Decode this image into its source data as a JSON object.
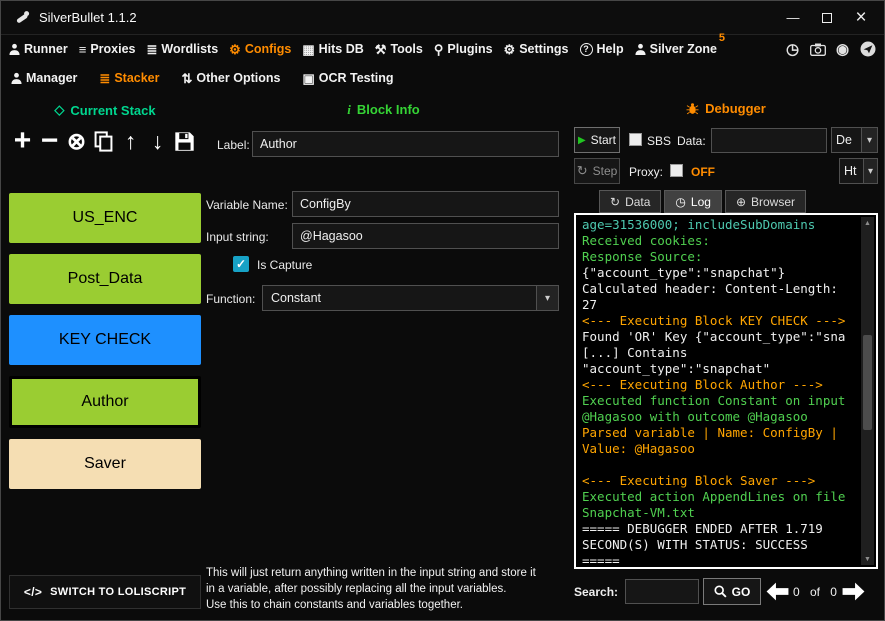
{
  "colors": {
    "accent_orange": "#ff8c00",
    "title_teal": "#00d68f",
    "info_green": "#35d435",
    "capture_blue": "#17a2c6",
    "start_green": "#21c521",
    "stack_green": "#9acd32",
    "key_blue": "#1e90ff",
    "saver_wheat": "#f5deb3",
    "log_teal": "#4ec9b0",
    "log_green": "#50d050",
    "log_white": "#f0f0f0",
    "log_orange": "#ffa500"
  },
  "window": {
    "title": "SilverBullet 1.1.2"
  },
  "titlebar": {
    "minimize": "—",
    "close": "×"
  },
  "nav": {
    "runner": "Runner",
    "proxies": "Proxies",
    "wordlists": "Wordlists",
    "configs": "Configs",
    "hitsdb": "Hits DB",
    "tools": "Tools",
    "plugins": "Plugins",
    "settings": "Settings",
    "help": "Help",
    "silverzone": "Silver Zone",
    "badge": "5"
  },
  "subnav": {
    "manager": "Manager",
    "stacker": "Stacker",
    "other_options": "Other Options",
    "ocr": "OCR Testing"
  },
  "icons": {
    "diamond": "◇",
    "plus": "+",
    "minus": "−",
    "remove": "⊗",
    "arrow_up": "↑",
    "arrow_down": "↓",
    "play": "▶",
    "step": "↻",
    "dropdown": "▾",
    "check": "✓",
    "proxies": "≡",
    "wordlists": "≣",
    "gear": "⚙",
    "hitsdb": "▦",
    "tools": "⚒",
    "plugins": "⚲",
    "help_mark": "?",
    "history": "◷",
    "record": "◉",
    "stacker": "≣",
    "options": "⇅",
    "ocr": "▣",
    "tab_data": "↻",
    "tab_log": "◷",
    "tab_browser": "⊕",
    "code": "</>",
    "info": "i",
    "scroll_up": "▲",
    "scroll_down": "▼"
  },
  "stack": {
    "title": "Current Stack",
    "blocks": [
      {
        "label": "US_ENC",
        "color": "#9acd32",
        "selected": false
      },
      {
        "label": "Post_Data",
        "color": "#9acd32",
        "selected": false
      },
      {
        "label": "KEY CHECK",
        "color": "#1e90ff",
        "selected": false
      },
      {
        "label": "Author",
        "color": "#9acd32",
        "selected": true
      },
      {
        "label": "Saver",
        "color": "#f5deb3",
        "selected": false
      }
    ],
    "switch_button": "SWITCH TO LOLISCRIPT"
  },
  "block_info": {
    "title": "Block Info",
    "label_caption": "Label:",
    "label_value": "Author",
    "variable_caption": "Variable Name:",
    "variable_value": "ConfigBy",
    "input_caption": "Input string:",
    "input_value": "@Hagasoo",
    "capture_label": "Is Capture",
    "function_caption": "Function:",
    "function_value": "Constant",
    "description_lines": [
      "This will just return anything written in the input string and store it",
      "in a variable, after possibly replacing all the input variables.",
      "Use this to chain constants and variables together."
    ]
  },
  "debugger": {
    "title": "Debugger",
    "start": "Start",
    "sbs": "SBS",
    "data_caption": "Data:",
    "data_value": "",
    "data_type": "De",
    "step": "Step",
    "proxy_caption": "Proxy:",
    "proxy_status": "OFF",
    "proxy_type": "Ht",
    "tabs": {
      "data": "Data",
      "log": "Log",
      "browser": "Browser"
    },
    "active_tab": "Log",
    "log": [
      {
        "text": "age=31536000; includeSubDomains",
        "color": "#4ec9b0"
      },
      {
        "text": "Received cookies:",
        "color": "#50d050"
      },
      {
        "text": "Response Source:",
        "color": "#50d050"
      },
      {
        "text": "{\"account_type\":\"snapchat\"}",
        "color": "#f0f0f0"
      },
      {
        "text": "Calculated header: Content-Length:",
        "color": "#f0f0f0"
      },
      {
        "text": "27",
        "color": "#f0f0f0"
      },
      {
        "text": "<--- Executing Block KEY CHECK --->",
        "color": "#ffa500"
      },
      {
        "text": "Found 'OR' Key {\"account_type\":\"sna",
        "color": "#f0f0f0"
      },
      {
        "text": "[...] Contains",
        "color": "#f0f0f0"
      },
      {
        "text": "\"account_type\":\"snapchat\"",
        "color": "#f0f0f0"
      },
      {
        "text": "<--- Executing Block Author --->",
        "color": "#ffa500"
      },
      {
        "text": "Executed function Constant on input",
        "color": "#50d050"
      },
      {
        "text": "@Hagasoo with outcome @Hagasoo",
        "color": "#50d050"
      },
      {
        "text": "Parsed variable | Name: ConfigBy |",
        "color": "#ffa500"
      },
      {
        "text": "Value: @Hagasoo",
        "color": "#ffa500"
      },
      {
        "text": "",
        "color": "#f0f0f0"
      },
      {
        "text": "<--- Executing Block Saver --->",
        "color": "#ffa500"
      },
      {
        "text": "Executed action AppendLines on file",
        "color": "#50d050"
      },
      {
        "text": "Snapchat-VM.txt",
        "color": "#50d050"
      },
      {
        "text": "===== DEBUGGER ENDED AFTER 1.719",
        "color": "#f0f0f0"
      },
      {
        "text": "SECOND(S) WITH STATUS: SUCCESS",
        "color": "#f0f0f0"
      },
      {
        "text": "=====",
        "color": "#f0f0f0"
      }
    ],
    "search_caption": "Search:",
    "search_value": "",
    "go": "GO",
    "counter": {
      "left": "0",
      "mid": "of",
      "right": "0"
    }
  }
}
